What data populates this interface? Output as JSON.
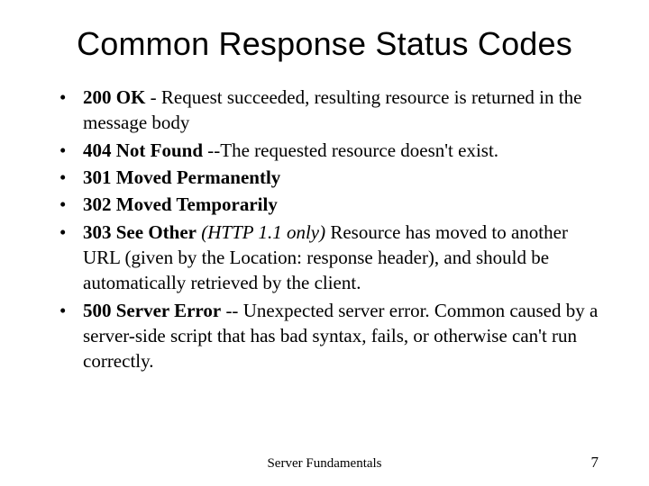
{
  "title": "Common Response Status Codes",
  "items": [
    {
      "lead_bold": "200 OK",
      "mid": " - ",
      "rest": "Request succeeded, resulting resource is returned in the message body",
      "italic": "",
      "tail": ""
    },
    {
      "lead_bold": "404 Not Found",
      "mid": " --",
      "rest": "The requested resource doesn't exist.",
      "italic": "",
      "tail": ""
    },
    {
      "lead_bold": "301 Moved Permanently",
      "mid": "",
      "rest": "",
      "italic": "",
      "tail": ""
    },
    {
      "lead_bold": "302 Moved Temporarily",
      "mid": "",
      "rest": "",
      "italic": "",
      "tail": ""
    },
    {
      "lead_bold": "303 See Other",
      "mid": " ",
      "rest": "",
      "italic": "(HTTP 1.1 only)",
      "tail": " Resource has moved to another URL (given by the Location: response header), and should be automatically retrieved by the client."
    },
    {
      "lead_bold": "500 Server Error",
      "mid": " -- ",
      "rest": "Unexpected server error. Common caused by a server-side script that has bad syntax, fails, or otherwise can't run correctly.",
      "italic": "",
      "tail": ""
    }
  ],
  "footer": {
    "center": "Server Fundamentals",
    "page": "7"
  }
}
